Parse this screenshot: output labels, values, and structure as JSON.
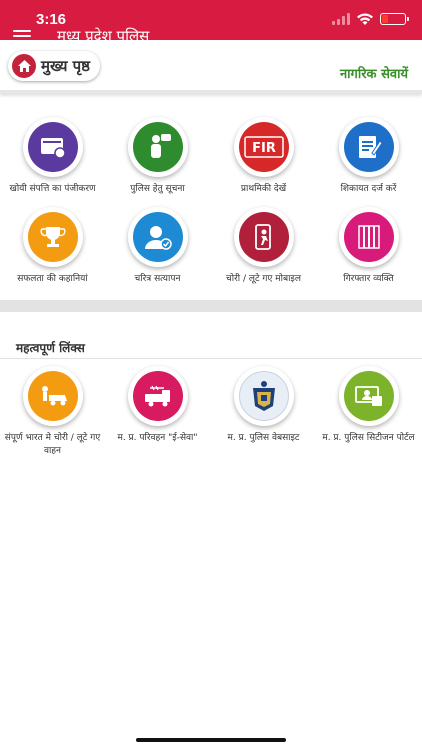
{
  "status_bar": {
    "time": "3:16"
  },
  "app": {
    "title": "मध्य प्रदेश पुलिस",
    "accent": "#d81b40"
  },
  "header": {
    "home_label": "मुख्य पृष्ठ",
    "citizen_services_label": "नागरिक सेवायें"
  },
  "services": [
    {
      "label": "खोयी संपत्ति का पंजीकरण",
      "icon": "lost-property-icon",
      "color": "#5a3a9e"
    },
    {
      "label": "पुलिस हेतु सूचना",
      "icon": "police-info-icon",
      "color": "#2e8b2e"
    },
    {
      "label": "प्राथमिकी देखें",
      "icon": "fir-icon",
      "color": "#d62828"
    },
    {
      "label": "शिकायत दर्ज करें",
      "icon": "complaint-icon",
      "color": "#1e6fc8"
    },
    {
      "label": "सफलता की कहानियां",
      "icon": "trophy-icon",
      "color": "#f39c12"
    },
    {
      "label": "चरित्र सत्यापन",
      "icon": "verification-icon",
      "color": "#1f8ad4"
    },
    {
      "label": "चोरी / लूटे गए मोबाइल",
      "icon": "stolen-mobile-icon",
      "color": "#b0203a"
    },
    {
      "label": "गिरफ्तार व्यक्ति",
      "icon": "arrested-icon",
      "color": "#d81b7a"
    }
  ],
  "links_section": {
    "title": "महत्वपूर्ण लिंक्स",
    "items": [
      {
        "label": "संपूर्ण भारत मे चोरी / लूटे गए वाहन",
        "icon": "stolen-vehicle-icon",
        "color": "#f39c12"
      },
      {
        "label": "म. प्र. परिवहन \"ई-सेवा\"",
        "icon": "transport-icon",
        "color": "#d81b60"
      },
      {
        "label": "म. प्र. पुलिस वेबसाइट",
        "icon": "police-emblem-icon",
        "color": "#e8eef5"
      },
      {
        "label": "म. प्र. पुलिस सिटीजन पोर्टल",
        "icon": "citizen-portal-icon",
        "color": "#7cb32a"
      }
    ]
  }
}
